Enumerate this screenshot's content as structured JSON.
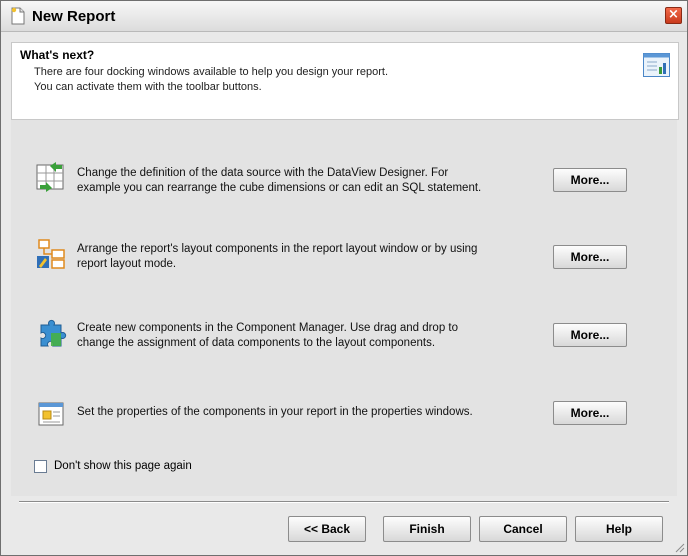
{
  "window": {
    "title": "New Report"
  },
  "header": {
    "heading": "What's next?",
    "lines": [
      "There are four docking windows available to help you design your report.",
      "You can activate them with the toolbar buttons."
    ]
  },
  "rows": [
    {
      "icon": "dataview-designer-icon",
      "text": [
        "Change the definition of the data source with the DataView Designer. For",
        "example you can rearrange the cube dimensions or can edit an SQL statement."
      ],
      "button": "More..."
    },
    {
      "icon": "report-layout-icon",
      "text": [
        "Arrange the report's layout components in the report layout window or by using",
        "report layout mode."
      ],
      "button": "More..."
    },
    {
      "icon": "component-manager-icon",
      "text": [
        "Create new components in the Component Manager. Use drag and drop to",
        "change the assignment of data components to the layout components."
      ],
      "button": "More..."
    },
    {
      "icon": "properties-window-icon",
      "text": [
        "Set the properties of the components in your report in the properties windows."
      ],
      "button": "More..."
    }
  ],
  "checkbox": {
    "label": "Don't show this page again",
    "checked": false
  },
  "footer": {
    "back": "<< Back",
    "finish": "Finish",
    "cancel": "Cancel",
    "help": "Help"
  }
}
